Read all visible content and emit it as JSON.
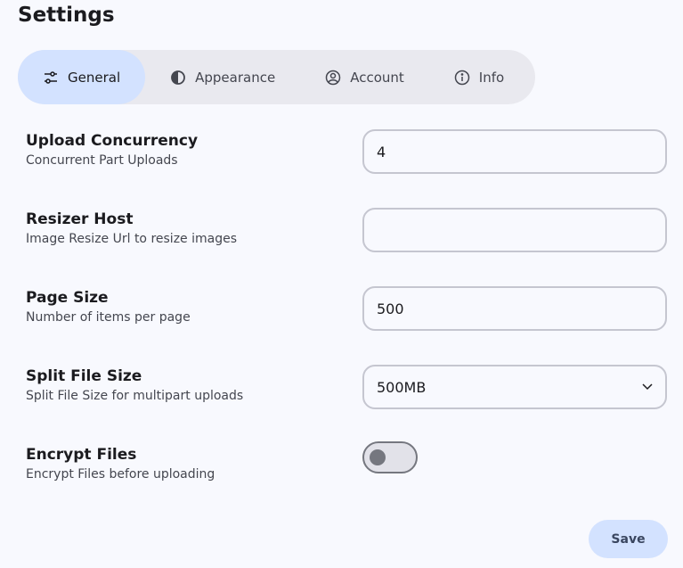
{
  "title": "Settings",
  "tabs": [
    {
      "label": "General",
      "icon": "sliders-icon"
    },
    {
      "label": "Appearance",
      "icon": "contrast-icon"
    },
    {
      "label": "Account",
      "icon": "account-icon"
    },
    {
      "label": "Info",
      "icon": "info-icon"
    }
  ],
  "fields": [
    {
      "title": "Upload Concurrency",
      "subtitle": "Concurrent Part Uploads",
      "value": "4"
    },
    {
      "title": "Resizer Host",
      "subtitle": "Image Resize Url to resize images",
      "value": ""
    },
    {
      "title": "Page Size",
      "subtitle": "Number of items per page",
      "value": "500"
    },
    {
      "title": "Split File Size",
      "subtitle": "Split File Size for multipart uploads",
      "value": "500MB"
    },
    {
      "title": "Encrypt Files",
      "subtitle": "Encrypt Files before uploading",
      "value": "off"
    }
  ],
  "save_label": "Save"
}
